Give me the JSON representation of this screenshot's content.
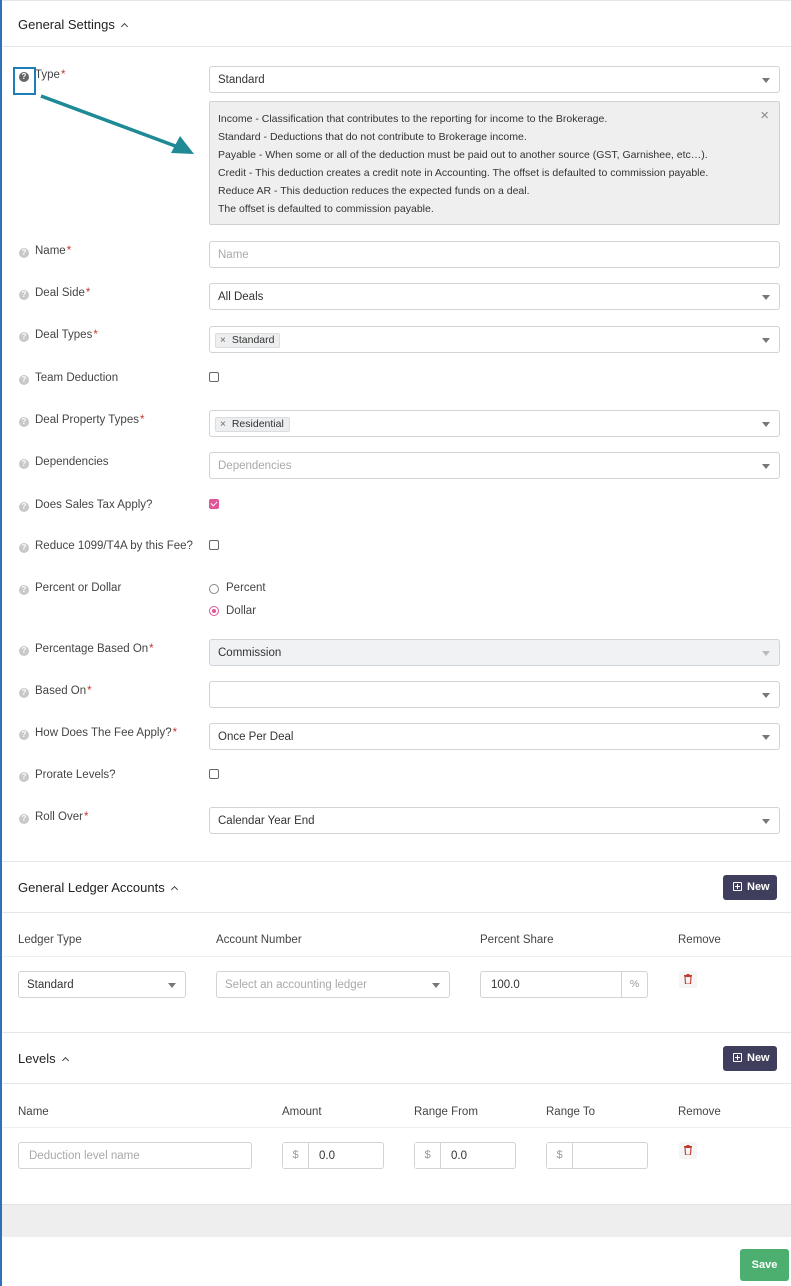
{
  "general_settings": {
    "title": "General Settings",
    "fields": {
      "type": {
        "label": "Type",
        "required": "*",
        "value": "Standard"
      },
      "type_info": {
        "lines": [
          "Income - Classification that contributes to the reporting for income to the Brokerage.",
          "Standard - Deductions that do not contribute to Brokerage income.",
          "Payable - When some or all of the deduction must be paid out to another source (GST, Garnishee, etc…).",
          "Credit - This deduction creates a credit note in Accounting. The offset is defaulted to commission payable.",
          "Reduce AR - This deduction reduces the expected funds on a deal.",
          "The offset is defaulted to commission payable."
        ],
        "close_glyph": "×"
      },
      "name": {
        "label": "Name",
        "required": "*",
        "placeholder": "Name"
      },
      "deal_side": {
        "label": "Deal Side",
        "required": "*",
        "value": "All Deals"
      },
      "deal_types": {
        "label": "Deal Types",
        "required": "*",
        "tag": "Standard",
        "tag_remove": "×"
      },
      "team_deduction": {
        "label": "Team Deduction",
        "checked": false
      },
      "deal_property_types": {
        "label": "Deal Property Types",
        "required": "*",
        "tag": "Residential",
        "tag_remove": "×"
      },
      "dependencies": {
        "label": "Dependencies",
        "placeholder": "Dependencies"
      },
      "sales_tax": {
        "label": "Does Sales Tax Apply?",
        "checked": true
      },
      "reduce_1099": {
        "label": "Reduce 1099/T4A by this Fee?",
        "checked": false
      },
      "percent_or_dollar": {
        "label": "Percent or Dollar",
        "options": [
          "Percent",
          "Dollar"
        ],
        "selected": "Dollar"
      },
      "percentage_based_on": {
        "label": "Percentage Based On",
        "required": "*",
        "value": "Commission"
      },
      "based_on": {
        "label": "Based On",
        "required": "*",
        "value": ""
      },
      "fee_apply": {
        "label": "How Does The Fee Apply?",
        "required": "*",
        "value": "Once Per Deal"
      },
      "prorate_levels": {
        "label": "Prorate Levels?",
        "checked": false
      },
      "roll_over": {
        "label": "Roll Over",
        "required": "*",
        "value": "Calendar Year End"
      }
    },
    "help_glyph": "?"
  },
  "ledger": {
    "title": "General Ledger Accounts",
    "new_label": "New",
    "columns": [
      "Ledger Type",
      "Account Number",
      "Percent Share",
      "Remove"
    ],
    "row": {
      "ledger_type": "Standard",
      "account_placeholder": "Select an accounting ledger",
      "percent_share": "100.0",
      "percent_suffix": "%"
    }
  },
  "levels": {
    "title": "Levels",
    "new_label": "New",
    "columns": [
      "Name",
      "Amount",
      "Range From",
      "Range To",
      "Remove"
    ],
    "row": {
      "name_placeholder": "Deduction level name",
      "currency": "$",
      "amount": "0.0",
      "range_from": "0.0",
      "range_to": ""
    }
  },
  "footer": {
    "save_label": "Save"
  },
  "colors": {
    "accent_pink": "#e2549a",
    "new_button": "#3f3e5c",
    "save_button": "#4caf6f",
    "annotation": "#1d7fb5",
    "required": "#c0392b"
  }
}
